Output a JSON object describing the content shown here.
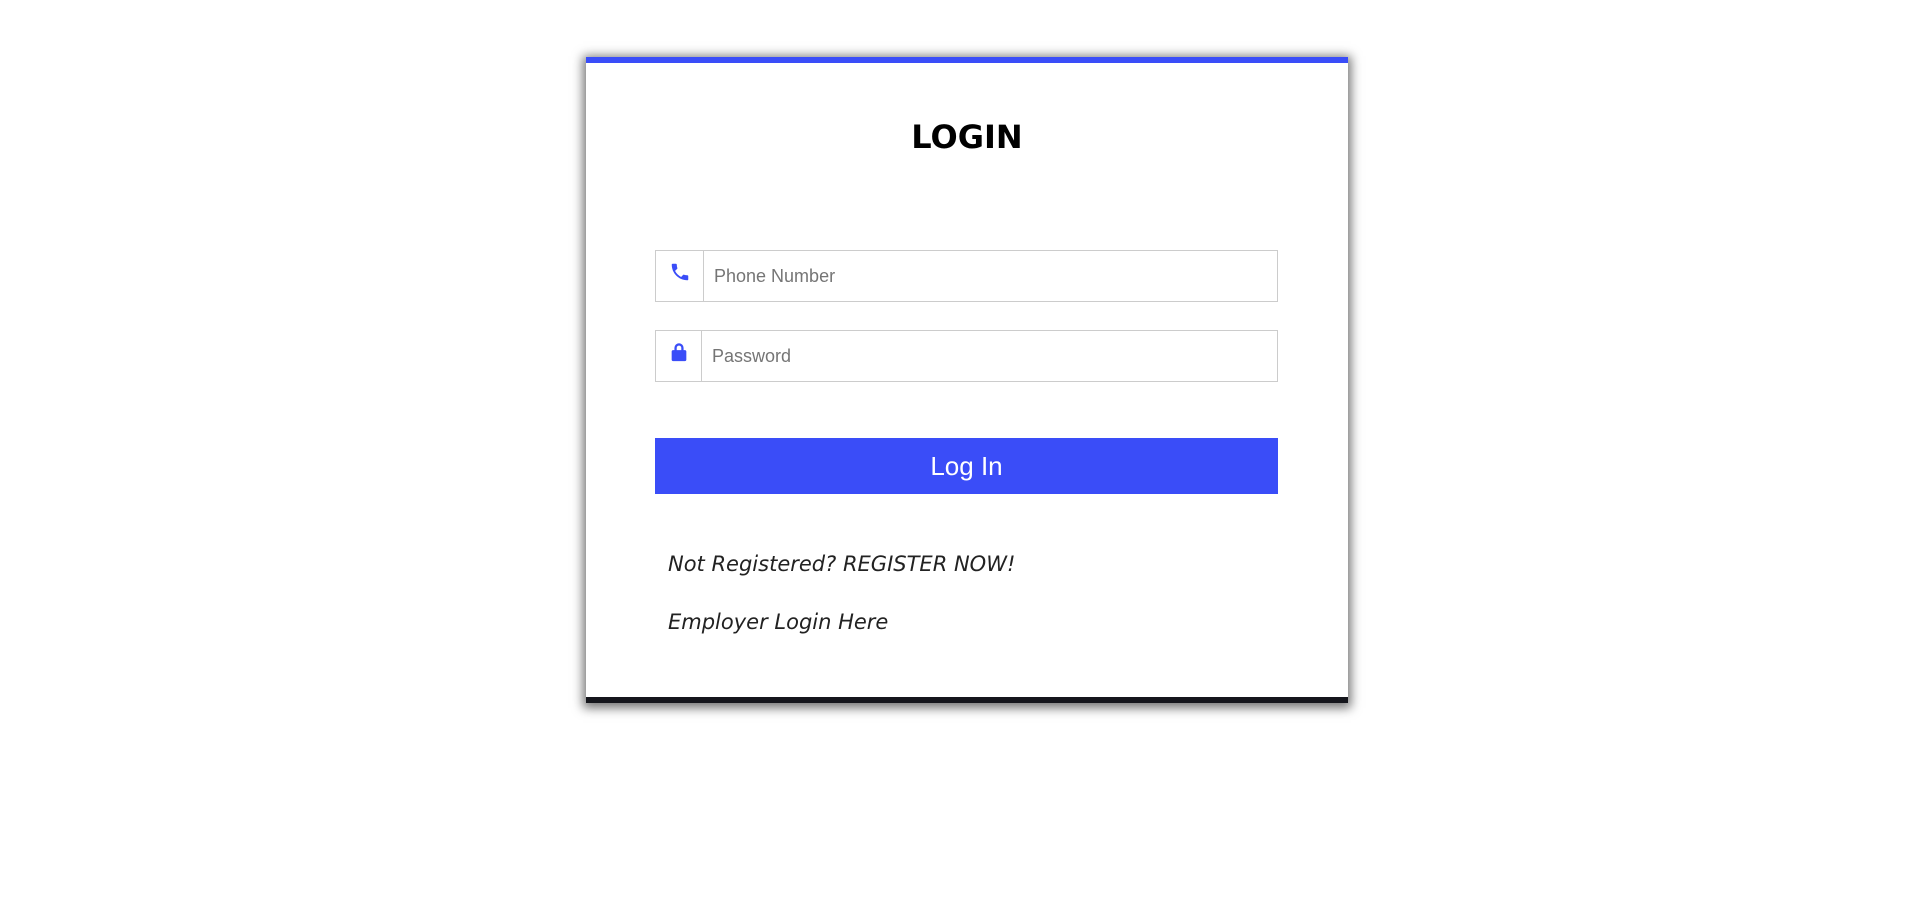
{
  "login": {
    "title": "LOGIN",
    "phone": {
      "placeholder": "Phone Number",
      "value": "",
      "icon": "phone-icon"
    },
    "password": {
      "placeholder": "Password",
      "value": "",
      "icon": "lock-icon"
    },
    "submit_label": "Log In",
    "register_link": "Not Registered? REGISTER NOW!",
    "employer_link": "Employer Login Here"
  },
  "colors": {
    "accent": "#3a4df8",
    "card_bottom_border": "#15161c",
    "input_border": "#cccccc",
    "text": "#222222"
  }
}
